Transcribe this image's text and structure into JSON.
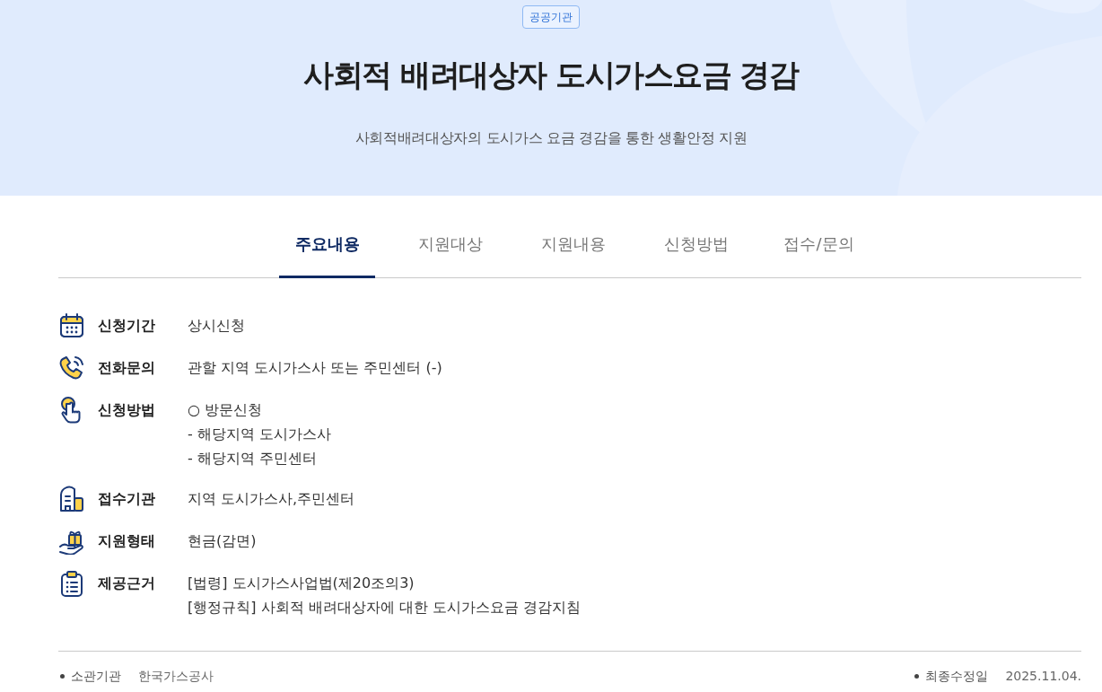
{
  "header": {
    "badge": "공공기관",
    "title": "사회적 배려대상자 도시가스요금 경감",
    "subtitle": "사회적배려대상자의 도시가스 요금 경감을 통한 생활안정 지원"
  },
  "tabs": [
    {
      "label": "주요내용",
      "selected": true
    },
    {
      "label": "지원대상",
      "selected": false
    },
    {
      "label": "지원내용",
      "selected": false
    },
    {
      "label": "신청방법",
      "selected": false
    },
    {
      "label": "접수/문의",
      "selected": false
    }
  ],
  "details": [
    {
      "kind": "calendar",
      "label": "신청기간",
      "lines": [
        "상시신청"
      ]
    },
    {
      "kind": "phone",
      "label": "전화문의",
      "lines": [
        "관할 지역 도시가스사 또는 주민센터 (-)"
      ]
    },
    {
      "kind": "pointer",
      "label": "신청방법",
      "lines": [
        "○ 방문신청",
        "- 해당지역 도시가스사",
        "- 해당지역 주민센터"
      ]
    },
    {
      "kind": "building",
      "label": "접수기관",
      "lines": [
        "지역 도시가스사,주민센터"
      ]
    },
    {
      "kind": "gift",
      "label": "지원형태",
      "lines": [
        "현금(감면)"
      ]
    },
    {
      "kind": "clipboard",
      "label": "제공근거",
      "lines": [
        "[법령] 도시가스사업법(제20조의3)",
        "[행정규칙] 사회적 배려대상자에 대한 도시가스요금 경감지침"
      ]
    }
  ],
  "footer": [
    {
      "label": "소관기관",
      "value": "한국가스공사"
    },
    {
      "label": "최종수정일",
      "value": "2025.11.04."
    }
  ]
}
